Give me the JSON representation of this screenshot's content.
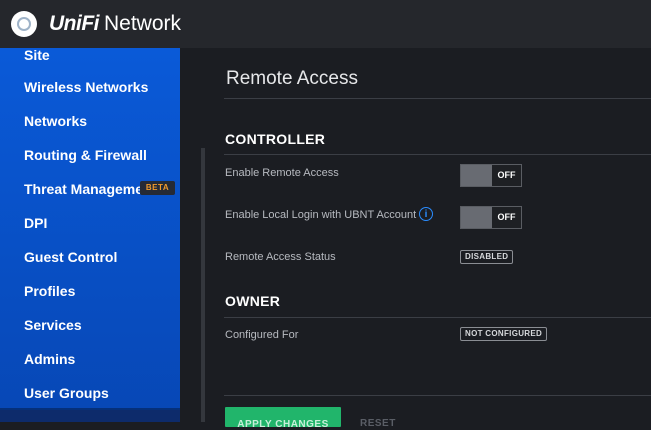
{
  "header": {
    "brand_unifi": "UniFi",
    "brand_network": "Network"
  },
  "sidebar": {
    "items": [
      {
        "label": "Site"
      },
      {
        "label": "Wireless Networks"
      },
      {
        "label": "Networks"
      },
      {
        "label": "Routing & Firewall"
      },
      {
        "label": "Threat Management",
        "badge": "BETA"
      },
      {
        "label": "DPI"
      },
      {
        "label": "Guest Control"
      },
      {
        "label": "Profiles"
      },
      {
        "label": "Services"
      },
      {
        "label": "Admins"
      },
      {
        "label": "User Groups"
      }
    ]
  },
  "main": {
    "title": "Remote Access",
    "controller": {
      "title": "CONTROLLER",
      "rows": [
        {
          "label": "Enable Remote Access",
          "toggle": "OFF"
        },
        {
          "label": "Enable Local Login with UBNT Account",
          "toggle": "OFF",
          "info_icon": "info-icon"
        },
        {
          "label": "Remote Access Status",
          "status": "DISABLED"
        }
      ]
    },
    "owner": {
      "title": "OWNER",
      "rows": [
        {
          "label": "Configured For",
          "status": "NOT CONFIGURED"
        }
      ]
    },
    "actions": {
      "apply": "APPLY CHANGES",
      "reset": "RESET"
    }
  },
  "colors": {
    "sidebar_blue": "#0a5ad8",
    "apply_green": "#21b56b",
    "info_blue": "#2a8cff",
    "beta_orange": "#f29b2c"
  }
}
